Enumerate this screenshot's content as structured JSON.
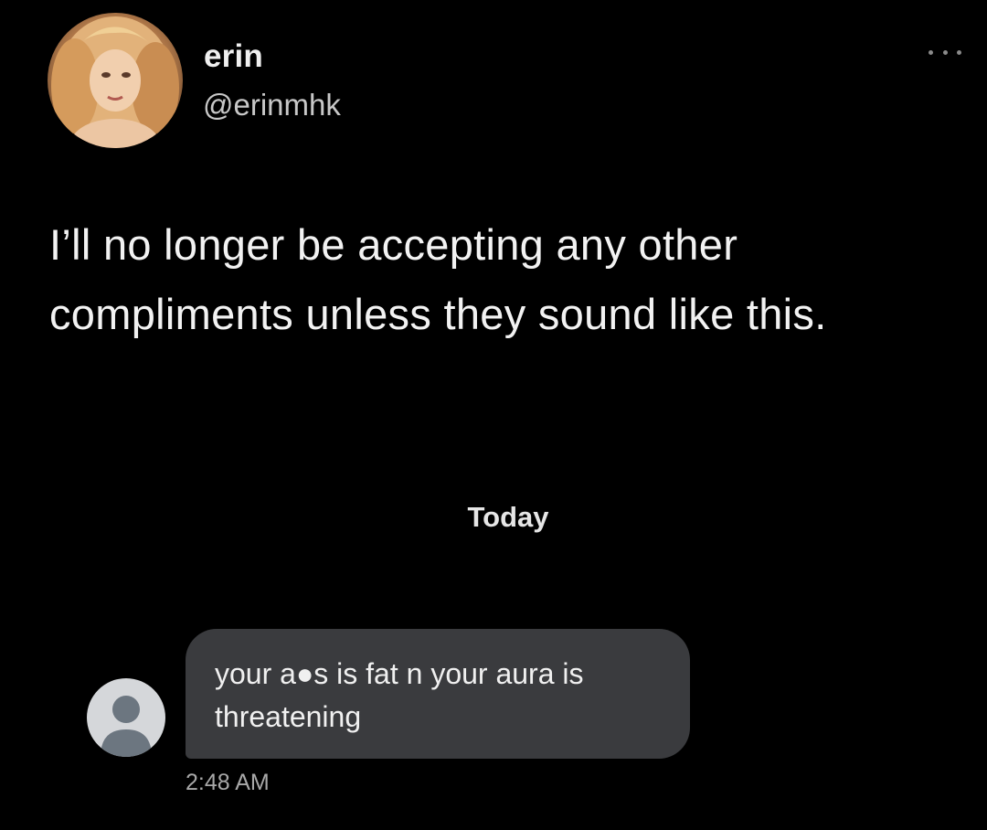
{
  "tweet": {
    "display_name": "erin",
    "handle": "@erinmhk",
    "text": "I’ll no longer be accepting any other compliments unless they sound like this.",
    "avatar_icon": "profile-photo",
    "more_icon": "more-horizontal-icon"
  },
  "conversation": {
    "day_label": "Today",
    "message": {
      "text": "your a●s is fat n your aura is threatening",
      "time": "2:48 AM",
      "sender_avatar_icon": "default-user-icon"
    }
  },
  "colors": {
    "background": "#000000",
    "bubble": "#3a3b3e",
    "text_primary": "#f2f2f2",
    "text_secondary": "#a8a8a8",
    "avatar_placeholder": "#d5d7da",
    "avatar_silhouette": "#6c7680"
  }
}
